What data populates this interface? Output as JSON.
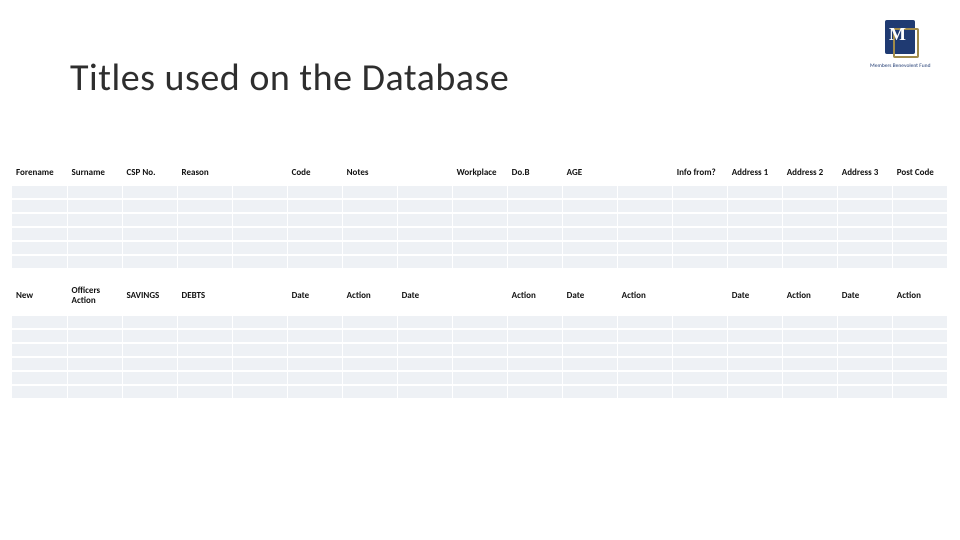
{
  "title": "Titles used on the Database",
  "logo": {
    "initial": "M",
    "caption": "Members Benevolent Fund"
  },
  "table1": {
    "headers": [
      "Forename",
      "Surname",
      "CSP No.",
      "Reason",
      "",
      "Code",
      "Notes",
      "",
      "Workplace",
      "Do.B",
      "AGE",
      "",
      "Info from?",
      "Address 1",
      "Address 2",
      "Address 3",
      "Post Code"
    ]
  },
  "table2": {
    "headers": [
      "New",
      "Officers Action",
      "SAVINGS",
      "DEBTS",
      "",
      "Date",
      "Action",
      "Date",
      "",
      "Action",
      "Date",
      "Action",
      "",
      "Date",
      "Action",
      "Date",
      "Action"
    ]
  }
}
